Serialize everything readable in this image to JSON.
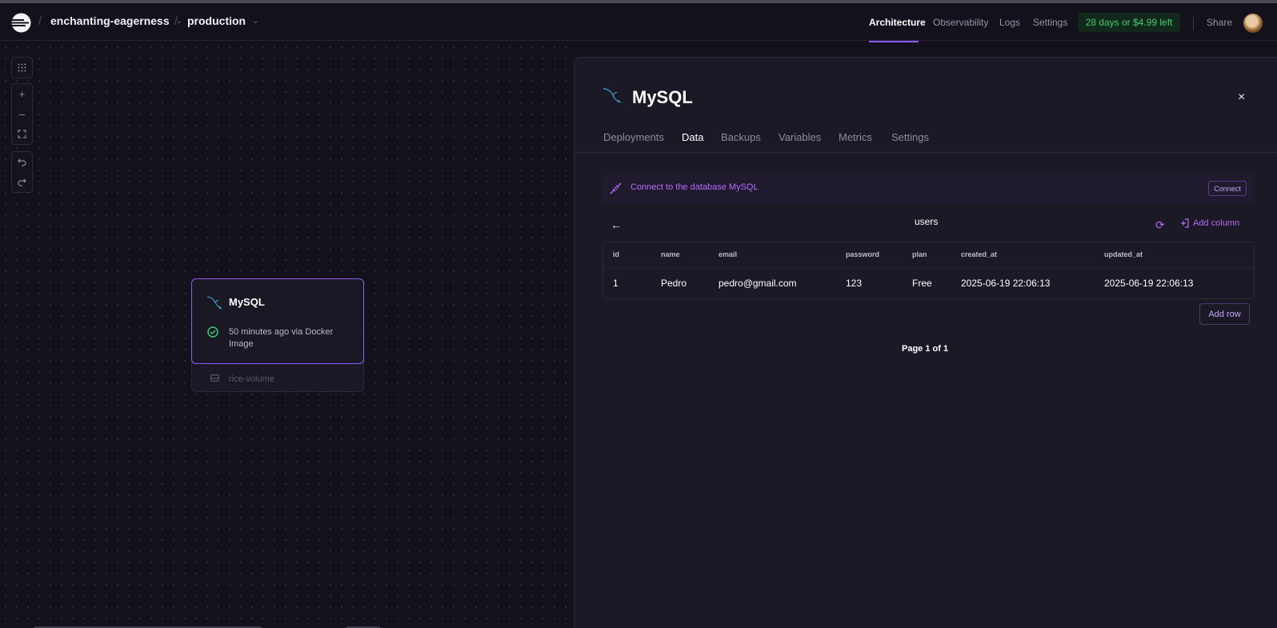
{
  "breadcrumb": {
    "project": "enchanting-eagerness",
    "environment": "production",
    "separator": "/"
  },
  "nav": {
    "items": [
      "Architecture",
      "Observability",
      "Logs",
      "Settings"
    ],
    "active": "Architecture",
    "trial": "28 days or $4.99 left",
    "share": "Share"
  },
  "canvas": {
    "controls": [
      "grid-icon",
      "zoom-in-icon",
      "zoom-out-icon",
      "fit-view-icon",
      "undo-icon",
      "redo-icon"
    ],
    "service_card": {
      "title": "MySQL",
      "status": "50 minutes ago via Docker Image",
      "volume": "rice-volume"
    }
  },
  "panel": {
    "title": "MySQL",
    "tabs": [
      "Deployments",
      "Data",
      "Backups",
      "Variables",
      "Metrics",
      "Settings"
    ],
    "active_tab": "Data",
    "banner": {
      "text": "Connect to the database MySQL",
      "button": "Connect"
    },
    "table": {
      "name": "users",
      "add_column": "Add column",
      "columns": [
        "id",
        "name",
        "email",
        "password",
        "plan",
        "created_at",
        "updated_at"
      ],
      "rows": [
        [
          "1",
          "Pedro",
          "pedro@gmail.com",
          "123",
          "Free",
          "2025-06-19 22:06:13",
          "2025-06-19 22:06:13"
        ]
      ],
      "add_row": "Add row",
      "pagination": "Page 1 of 1"
    }
  },
  "colors": {
    "background": "#13111c",
    "panel": "#1b1925",
    "accent": "#8b5cf6",
    "success": "#3ecf6f"
  }
}
